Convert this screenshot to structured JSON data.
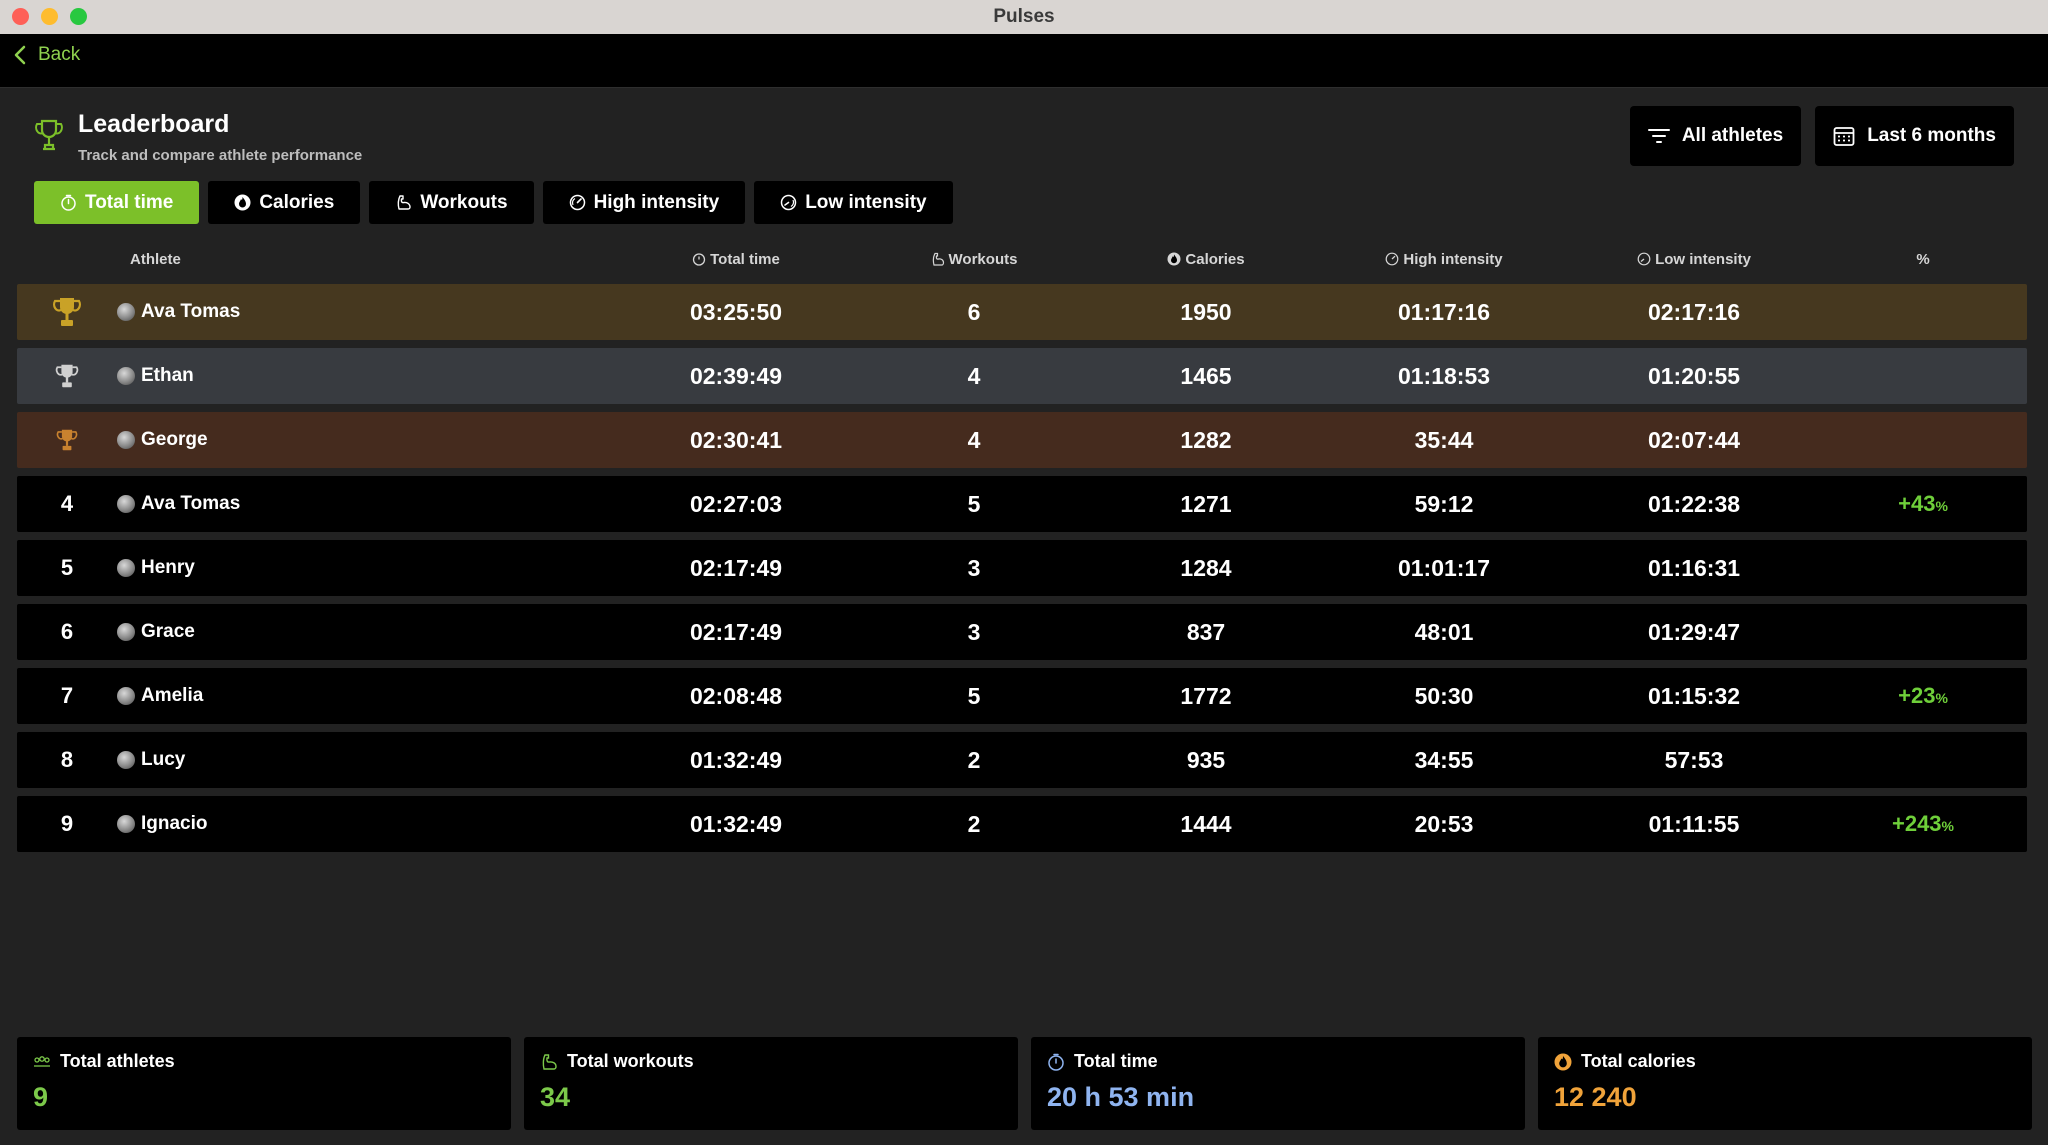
{
  "window": {
    "title": "Pulses"
  },
  "nav": {
    "back_label": "Back"
  },
  "header": {
    "title": "Leaderboard",
    "subtitle": "Track and compare athlete performance"
  },
  "filters": {
    "athletes_label": "All athletes",
    "period_label": "Last 6 months"
  },
  "tabs": [
    {
      "label": "Total time",
      "icon": "stopwatch-icon",
      "active": true
    },
    {
      "label": "Calories",
      "icon": "flame-icon",
      "active": false
    },
    {
      "label": "Workouts",
      "icon": "muscle-icon",
      "active": false
    },
    {
      "label": "High intensity",
      "icon": "gauge-high-icon",
      "active": false
    },
    {
      "label": "Low intensity",
      "icon": "gauge-low-icon",
      "active": false
    }
  ],
  "table": {
    "columns": {
      "athlete": "Athlete",
      "total_time": "Total time",
      "workouts": "Workouts",
      "calories": "Calories",
      "high_intensity": "High intensity",
      "low_intensity": "Low intensity",
      "percent": "%"
    },
    "rows": [
      {
        "rank": "",
        "medal": "gold",
        "name": "Ava Tomas",
        "total_time": "03:25:50",
        "workouts": "6",
        "calories": "1950",
        "high": "01:17:16",
        "low": "02:17:16",
        "pct": ""
      },
      {
        "rank": "",
        "medal": "silver",
        "name": "Ethan",
        "total_time": "02:39:49",
        "workouts": "4",
        "calories": "1465",
        "high": "01:18:53",
        "low": "01:20:55",
        "pct": ""
      },
      {
        "rank": "",
        "medal": "bronze",
        "name": "George",
        "total_time": "02:30:41",
        "workouts": "4",
        "calories": "1282",
        "high": "35:44",
        "low": "02:07:44",
        "pct": ""
      },
      {
        "rank": "4",
        "medal": "",
        "name": "Ava Tomas",
        "total_time": "02:27:03",
        "workouts": "5",
        "calories": "1271",
        "high": "59:12",
        "low": "01:22:38",
        "pct": "+43"
      },
      {
        "rank": "5",
        "medal": "",
        "name": "Henry",
        "total_time": "02:17:49",
        "workouts": "3",
        "calories": "1284",
        "high": "01:01:17",
        "low": "01:16:31",
        "pct": ""
      },
      {
        "rank": "6",
        "medal": "",
        "name": "Grace",
        "total_time": "02:17:49",
        "workouts": "3",
        "calories": "837",
        "high": "48:01",
        "low": "01:29:47",
        "pct": ""
      },
      {
        "rank": "7",
        "medal": "",
        "name": "Amelia",
        "total_time": "02:08:48",
        "workouts": "5",
        "calories": "1772",
        "high": "50:30",
        "low": "01:15:32",
        "pct": "+23"
      },
      {
        "rank": "8",
        "medal": "",
        "name": "Lucy",
        "total_time": "01:32:49",
        "workouts": "2",
        "calories": "935",
        "high": "34:55",
        "low": "57:53",
        "pct": ""
      },
      {
        "rank": "9",
        "medal": "",
        "name": "Ignacio",
        "total_time": "01:32:49",
        "workouts": "2",
        "calories": "1444",
        "high": "20:53",
        "low": "01:11:55",
        "pct": "+243"
      }
    ],
    "pct_suffix": "%"
  },
  "stats": [
    {
      "label": "Total athletes",
      "value": "9",
      "icon": "group-icon",
      "color": "#7cc94a"
    },
    {
      "label": "Total workouts",
      "value": "34",
      "icon": "muscle-icon",
      "color": "#7cc94a"
    },
    {
      "label": "Total time",
      "value": "20 h 53 min",
      "icon": "stopwatch-icon",
      "color": "#8fb4f0"
    },
    {
      "label": "Total calories",
      "value": "12 240",
      "icon": "flame-icon",
      "color": "#f0a33a"
    }
  ],
  "colors": {
    "accent": "#7cc029",
    "gold": "#c9a227",
    "silver": "#d0d0d0",
    "bronze": "#c9822f"
  }
}
